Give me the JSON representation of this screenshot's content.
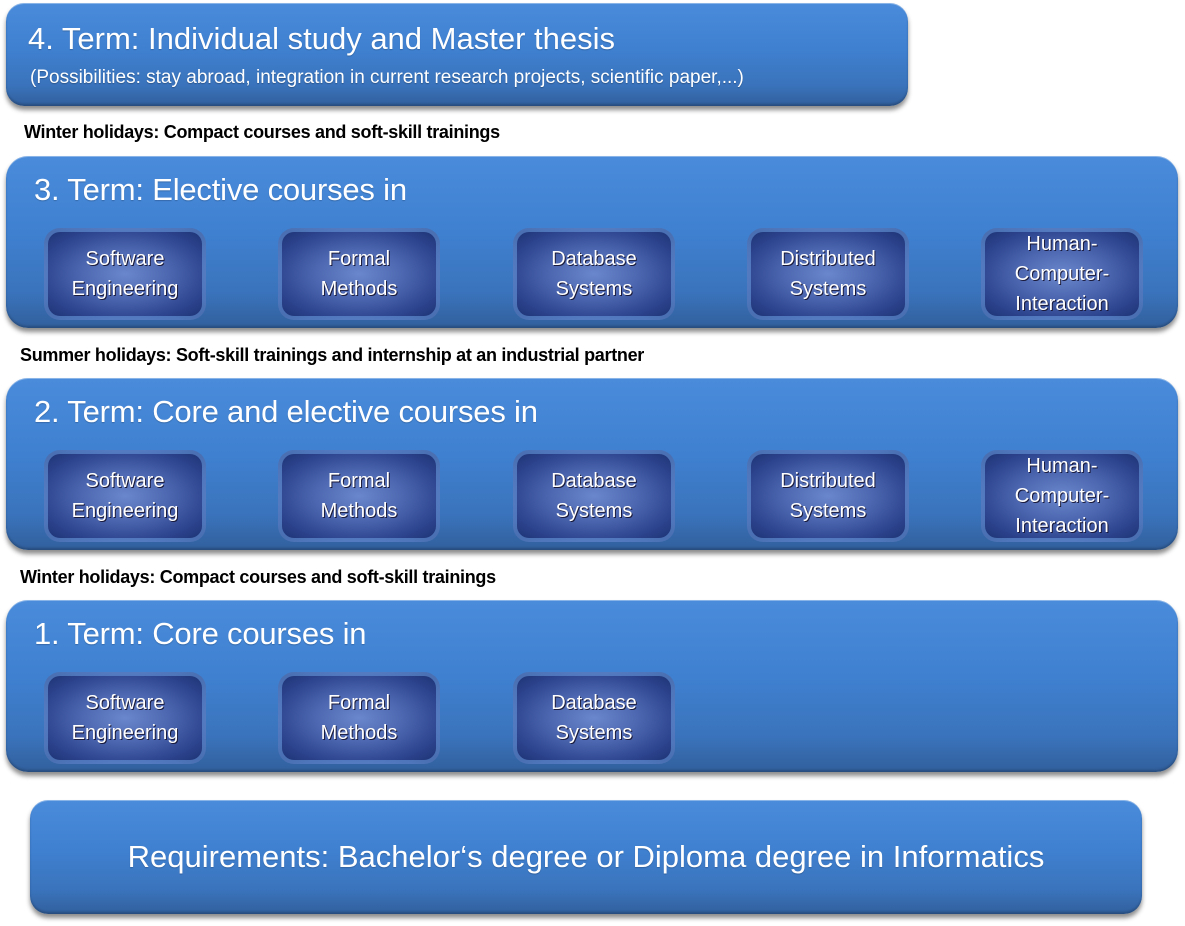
{
  "colors": {
    "term_box": "#3f80d0",
    "course_box": "#2e4590",
    "text_light": "#ffffff",
    "text_dark": "#000000"
  },
  "term4": {
    "title": "4. Term: Individual study and Master thesis",
    "subtitle": "(Possibilities: stay abroad, integration in current research projects, scientific paper,...)"
  },
  "holidays": [
    {
      "label": "Winter holidays: Compact courses and soft-skill trainings"
    },
    {
      "label": "Summer holidays: Soft-skill trainings and internship at an industrial partner"
    },
    {
      "label": "Winter holidays: Compact courses and soft-skill trainings"
    }
  ],
  "term3": {
    "title": "3. Term: Elective courses in",
    "courses": [
      "Software\nEngineering",
      "Formal\nMethods",
      "Database\nSystems",
      "Distributed\nSystems",
      "Human-\nComputer-\nInteraction"
    ]
  },
  "term2": {
    "title": "2. Term: Core and elective courses in",
    "courses": [
      "Software\nEngineering",
      "Formal\nMethods",
      "Database\nSystems",
      "Distributed\nSystems",
      "Human-\nComputer-\nInteraction"
    ]
  },
  "term1": {
    "title": "1. Term: Core courses in",
    "courses": [
      "Software\nEngineering",
      "Formal\nMethods",
      "Database\nSystems"
    ]
  },
  "requirements": {
    "text": "Requirements: Bachelor‘s degree or Diploma degree in Informatics"
  }
}
